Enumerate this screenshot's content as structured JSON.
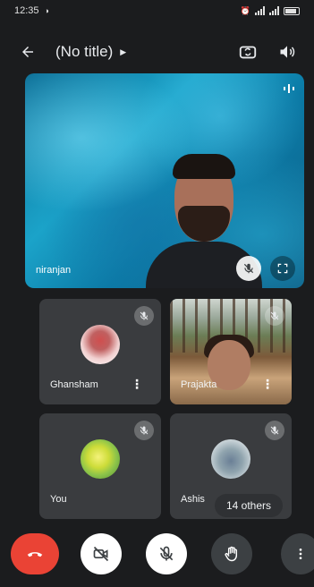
{
  "status_bar": {
    "time": "12:35"
  },
  "app_bar": {
    "title": "(No title)"
  },
  "main_tile": {
    "participant_name": "niranjan"
  },
  "tiles": [
    {
      "name": "Ghansham"
    },
    {
      "name": "Prajakta"
    },
    {
      "name": "You"
    },
    {
      "name": "Ashis"
    }
  ],
  "others_label": "14 others",
  "colors": {
    "end_call": "#ea4335",
    "background": "#1b1c1e",
    "tile": "#3a3c3f"
  },
  "icons": {
    "back": "arrow-left-icon",
    "switch_camera": "switch-camera-icon",
    "speaker": "speaker-icon",
    "mic_off": "mic-off-icon",
    "fullscreen": "fullscreen-icon",
    "more": "more-vert-icon",
    "end_call": "phone-hangup-icon",
    "camera_off": "video-off-icon",
    "raise_hand": "hand-icon"
  }
}
